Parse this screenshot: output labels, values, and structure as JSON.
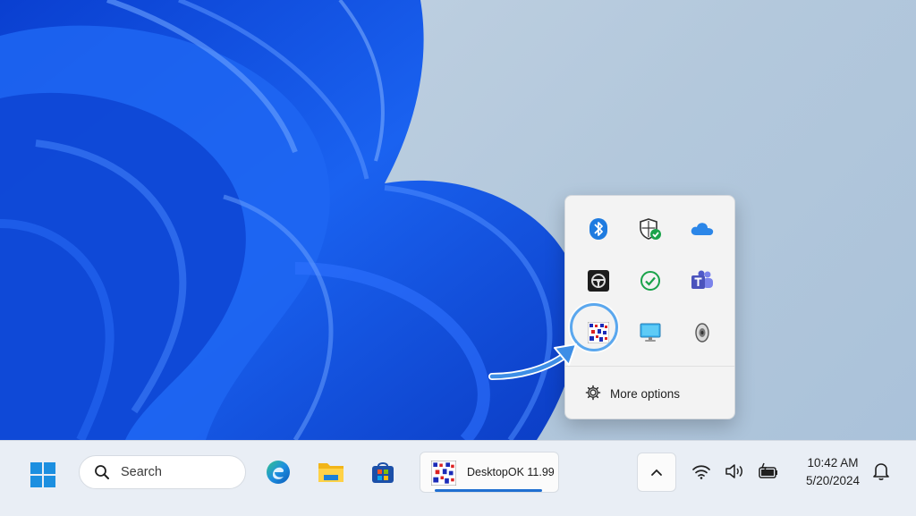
{
  "tray_overflow": {
    "icons": [
      {
        "icon": "bluetooth-icon"
      },
      {
        "icon": "windows-security-icon"
      },
      {
        "icon": "onedrive-icon"
      },
      {
        "icon": "steering-wheel-app-icon"
      },
      {
        "icon": "check-circle-icon"
      },
      {
        "icon": "teams-icon"
      },
      {
        "icon": "desktopok-icon"
      },
      {
        "icon": "display-icon"
      },
      {
        "icon": "speaker-icon"
      }
    ],
    "more_options_label": "More options"
  },
  "taskbar": {
    "start_icon": "windows-start-icon",
    "search_label": "Search",
    "pinned": [
      {
        "icon": "edge-icon"
      },
      {
        "icon": "file-explorer-icon"
      },
      {
        "icon": "microsoft-store-icon"
      }
    ],
    "running_app": {
      "label": "DesktopOK  11.99",
      "icon": "desktopok-icon"
    },
    "system_tray": {
      "chevron_icon": "chevron-up-icon",
      "icons": [
        "wifi-icon",
        "volume-icon",
        "battery-icon"
      ],
      "time": "10:42 AM",
      "date": "5/20/2024",
      "notification_icon": "bell-icon"
    }
  },
  "colors": {
    "accent": "#1f6fd1",
    "highlight_ring": "#5aa7ee",
    "wallpaper_blue": "#1459e6"
  }
}
